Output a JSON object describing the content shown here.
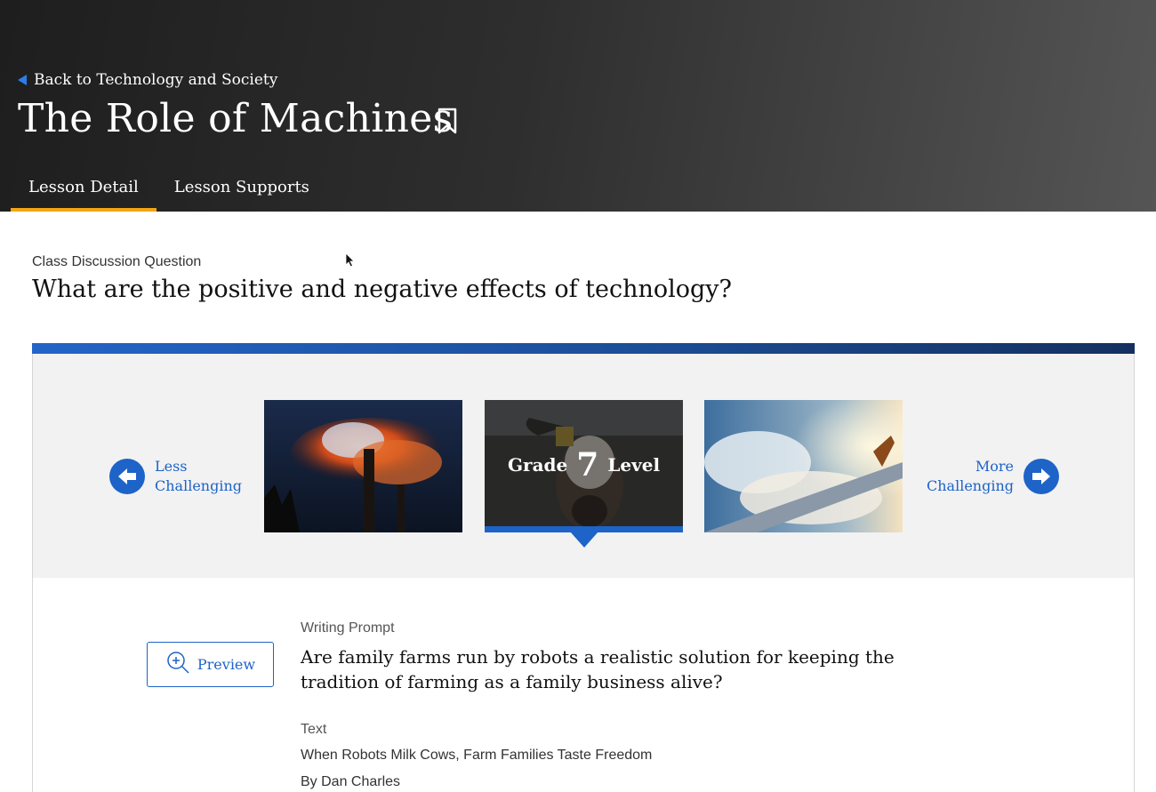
{
  "header": {
    "back_link": "Back to Technology and Society",
    "title": "The Role of Machines",
    "bookmark_icon": "bookmark-icon",
    "tabs": [
      {
        "label": "Lesson Detail",
        "active": true
      },
      {
        "label": "Lesson Supports",
        "active": false
      }
    ]
  },
  "question": {
    "label": "Class Discussion Question",
    "text": "What are the positive and negative effects of technology?"
  },
  "level_selector": {
    "less": {
      "line1": "Less",
      "line2": "Challenging",
      "icon": "arrow-left-icon"
    },
    "more": {
      "line1": "More",
      "line2": "Challenging",
      "icon": "arrow-right-icon"
    },
    "selected": {
      "prefix": "Grade",
      "number": "7",
      "suffix": "Level"
    },
    "thumbnails": [
      "smokestack-pollution-image",
      "cow-image",
      "airplane-wing-image"
    ]
  },
  "content": {
    "preview_label": "Preview",
    "writing_prompt_label": "Writing Prompt",
    "writing_prompt_text": "Are family farms run by robots a realistic solution for keeping the tradition of farming as a family business alive?",
    "text_label": "Text",
    "text_title": "When Robots Milk Cows, Farm Families Taste Freedom",
    "text_author": "By Dan Charles"
  },
  "colors": {
    "accent_blue": "#1d63c8",
    "tab_underline": "#f2a516",
    "header_dark": "#1e1e1e"
  }
}
